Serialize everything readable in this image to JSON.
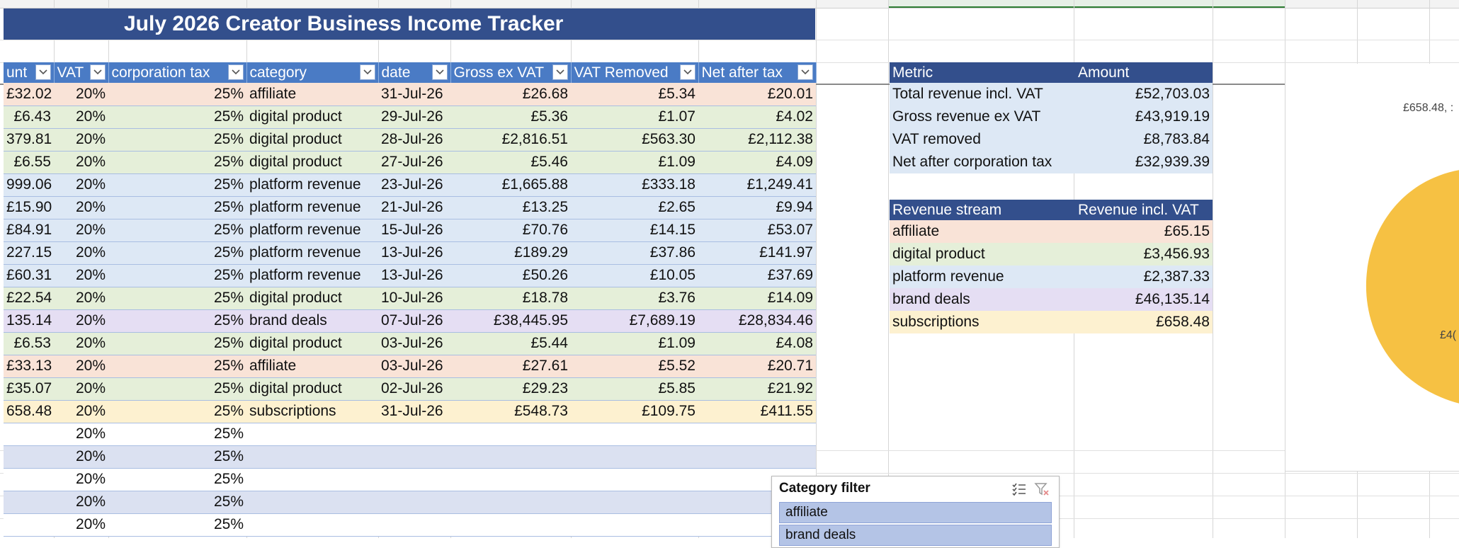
{
  "title": "July 2026 Creator Business Income Tracker",
  "table": {
    "headers": [
      {
        "label": "unt"
      },
      {
        "label": "VAT"
      },
      {
        "label": "corporation tax"
      },
      {
        "label": "category"
      },
      {
        "label": "date"
      },
      {
        "label": "Gross ex VAT"
      },
      {
        "label": "VAT Removed"
      },
      {
        "label": "Net after tax"
      }
    ],
    "rows": [
      {
        "amount": "£32.02",
        "vat": "20%",
        "corp": "25%",
        "category": "affiliate",
        "date": "31-Jul-26",
        "gross": "£26.68",
        "vat_removed": "£5.34",
        "net": "£20.01",
        "color": "aff"
      },
      {
        "amount": "£6.43",
        "vat": "20%",
        "corp": "25%",
        "category": "digital product",
        "date": "29-Jul-26",
        "gross": "£5.36",
        "vat_removed": "£1.07",
        "net": "£4.02",
        "color": "dig"
      },
      {
        "amount": "379.81",
        "vat": "20%",
        "corp": "25%",
        "category": "digital product",
        "date": "28-Jul-26",
        "gross": "£2,816.51",
        "vat_removed": "£563.30",
        "net": "£2,112.38",
        "color": "dig"
      },
      {
        "amount": "£6.55",
        "vat": "20%",
        "corp": "25%",
        "category": "digital product",
        "date": "27-Jul-26",
        "gross": "£5.46",
        "vat_removed": "£1.09",
        "net": "£4.09",
        "color": "dig"
      },
      {
        "amount": "999.06",
        "vat": "20%",
        "corp": "25%",
        "category": "platform revenue",
        "date": "23-Jul-26",
        "gross": "£1,665.88",
        "vat_removed": "£333.18",
        "net": "£1,249.41",
        "color": "plat"
      },
      {
        "amount": "£15.90",
        "vat": "20%",
        "corp": "25%",
        "category": "platform revenue",
        "date": "21-Jul-26",
        "gross": "£13.25",
        "vat_removed": "£2.65",
        "net": "£9.94",
        "color": "plat"
      },
      {
        "amount": "£84.91",
        "vat": "20%",
        "corp": "25%",
        "category": "platform revenue",
        "date": "15-Jul-26",
        "gross": "£70.76",
        "vat_removed": "£14.15",
        "net": "£53.07",
        "color": "plat"
      },
      {
        "amount": "227.15",
        "vat": "20%",
        "corp": "25%",
        "category": "platform revenue",
        "date": "13-Jul-26",
        "gross": "£189.29",
        "vat_removed": "£37.86",
        "net": "£141.97",
        "color": "plat"
      },
      {
        "amount": "£60.31",
        "vat": "20%",
        "corp": "25%",
        "category": "platform revenue",
        "date": "13-Jul-26",
        "gross": "£50.26",
        "vat_removed": "£10.05",
        "net": "£37.69",
        "color": "plat"
      },
      {
        "amount": "£22.54",
        "vat": "20%",
        "corp": "25%",
        "category": "digital product",
        "date": "10-Jul-26",
        "gross": "£18.78",
        "vat_removed": "£3.76",
        "net": "£14.09",
        "color": "dig"
      },
      {
        "amount": "135.14",
        "vat": "20%",
        "corp": "25%",
        "category": "brand deals",
        "date": "07-Jul-26",
        "gross": "£38,445.95",
        "vat_removed": "£7,689.19",
        "net": "£28,834.46",
        "color": "brand"
      },
      {
        "amount": "£6.53",
        "vat": "20%",
        "corp": "25%",
        "category": "digital product",
        "date": "03-Jul-26",
        "gross": "£5.44",
        "vat_removed": "£1.09",
        "net": "£4.08",
        "color": "dig"
      },
      {
        "amount": "£33.13",
        "vat": "20%",
        "corp": "25%",
        "category": "affiliate",
        "date": "03-Jul-26",
        "gross": "£27.61",
        "vat_removed": "£5.52",
        "net": "£20.71",
        "color": "aff"
      },
      {
        "amount": "£35.07",
        "vat": "20%",
        "corp": "25%",
        "category": "digital product",
        "date": "02-Jul-26",
        "gross": "£29.23",
        "vat_removed": "£5.85",
        "net": "£21.92",
        "color": "dig"
      },
      {
        "amount": "658.48",
        "vat": "20%",
        "corp": "25%",
        "category": "subscriptions",
        "date": "31-Jul-26",
        "gross": "£548.73",
        "vat_removed": "£109.75",
        "net": "£411.55",
        "color": "sub"
      },
      {
        "amount": "",
        "vat": "20%",
        "corp": "25%",
        "category": "",
        "date": "",
        "gross": "",
        "vat_removed": "",
        "net": "",
        "color": "none"
      },
      {
        "amount": "",
        "vat": "20%",
        "corp": "25%",
        "category": "",
        "date": "",
        "gross": "",
        "vat_removed": "",
        "net": "",
        "color": "band"
      },
      {
        "amount": "",
        "vat": "20%",
        "corp": "25%",
        "category": "",
        "date": "",
        "gross": "",
        "vat_removed": "",
        "net": "",
        "color": "none"
      },
      {
        "amount": "",
        "vat": "20%",
        "corp": "25%",
        "category": "",
        "date": "",
        "gross": "",
        "vat_removed": "",
        "net": "",
        "color": "band"
      },
      {
        "amount": "",
        "vat": "20%",
        "corp": "25%",
        "category": "",
        "date": "",
        "gross": "",
        "vat_removed": "",
        "net": "",
        "color": "none"
      }
    ]
  },
  "metrics": {
    "header_metric": "Metric",
    "header_amount": "Amount",
    "rows": [
      {
        "label": "Total revenue incl. VAT",
        "value": "£52,703.03"
      },
      {
        "label": "Gross revenue ex VAT",
        "value": "£43,919.19"
      },
      {
        "label": "VAT removed",
        "value": "£8,783.84"
      },
      {
        "label": "Net after corporation tax",
        "value": "£32,939.39"
      }
    ]
  },
  "streams": {
    "header_stream": "Revenue stream",
    "header_value": "Revenue incl. VAT",
    "rows": [
      {
        "label": "affiliate",
        "value": "£65.15",
        "color": "aff"
      },
      {
        "label": "digital product",
        "value": "£3,456.93",
        "color": "dig"
      },
      {
        "label": "platform revenue",
        "value": "£2,387.33",
        "color": "plat"
      },
      {
        "label": "brand deals",
        "value": "£46,135.14",
        "color": "brand"
      },
      {
        "label": "subscriptions",
        "value": "£658.48",
        "color": "sub"
      }
    ]
  },
  "chart": {
    "label_top": "£658.48, :",
    "label_mid": "£4(",
    "slice_color": "#f6c143"
  },
  "slicer": {
    "title": "Category filter",
    "items": [
      "affiliate",
      "brand deals"
    ]
  },
  "colors": {
    "title_bg": "#334f8c",
    "header_bg": "#4a7bc5"
  }
}
